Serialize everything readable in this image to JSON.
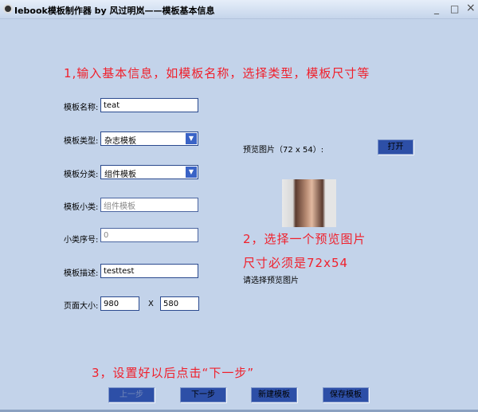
{
  "window": {
    "title": "Iebook模板制作器 by 风过明岚——模板基本信息",
    "minimize": "_",
    "maximize": "□",
    "close": "×"
  },
  "hints": {
    "step1": "1,输入基本信息，如模板名称，选择类型，模板尺寸等",
    "step2": "2，选择一个预览图片",
    "step2b": "尺寸必须是72x54",
    "step3": "3，设置好以后点击“下一步”"
  },
  "form": {
    "name_label": "模板名称:",
    "name_value": "teat",
    "type_label": "模板类型:",
    "type_value": "杂志模板",
    "category_label": "模板分类:",
    "category_value": "组件模板",
    "subtype_label": "模板小类:",
    "subtype_value": "组件模板",
    "seq_label": "小类序号:",
    "seq_value": "0",
    "desc_label": "模板描述:",
    "desc_value": "testtest",
    "size_label": "页面大小:",
    "width_value": "980",
    "x_sep": "X",
    "height_value": "580"
  },
  "preview": {
    "label": "预览图片（72 x 54）:",
    "open_button": "打开",
    "status": "请选择预览图片"
  },
  "buttons": {
    "prev": "上一步",
    "next": "下一步",
    "new": "新建模板",
    "save": "保存模板"
  }
}
